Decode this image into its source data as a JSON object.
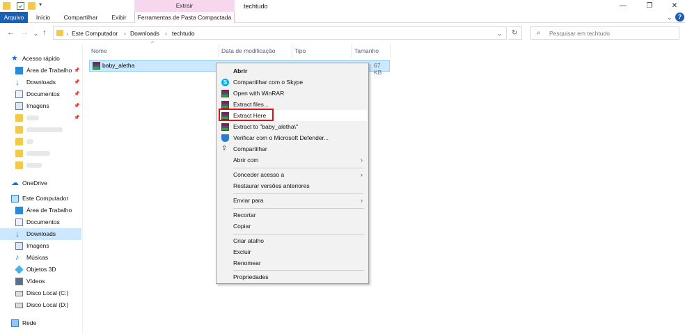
{
  "window": {
    "title": "techtudo",
    "context_header": "Extrair",
    "ribbon_tabs": [
      "Arquivo",
      "Início",
      "Compartilhar",
      "Exibir"
    ],
    "context_tab": "Ferramentas de Pasta Compactada"
  },
  "address": {
    "breadcrumbs": [
      "Este Computador",
      "Downloads",
      "techtudo"
    ],
    "search_placeholder": "Pesquisar em techtudo"
  },
  "nav": {
    "quick_access": "Acesso rápido",
    "quick_items": [
      "Área de Trabalho",
      "Downloads",
      "Documentos",
      "Imagens"
    ],
    "onedrive": "OneDrive",
    "this_pc": "Este Computador",
    "pc_items": [
      "Área de Trabalho",
      "Documentos",
      "Downloads",
      "Imagens",
      "Músicas",
      "Objetos 3D",
      "Vídeos",
      "Disco Local (C:)",
      "Disco Local (D:)"
    ],
    "network": "Rede",
    "selected": "Downloads"
  },
  "columns": [
    "Nome",
    "Data de modificação",
    "Tipo",
    "Tamanho"
  ],
  "file": {
    "name": "baby_aletha",
    "size": "67 KB"
  },
  "menu": {
    "items": [
      "Abrir",
      "Compartilhar com o Skype",
      "Open with WinRAR",
      "Extract files...",
      "Extract Here",
      "Extract to \"baby_aletha\\\"",
      "Verificar com o Microsoft Defender...",
      "Compartilhar",
      "Abrir com",
      "Conceder acesso a",
      "Restaurar versões anteriores",
      "Enviar para",
      "Recortar",
      "Copiar",
      "Criar atalho",
      "Excluir",
      "Renomear",
      "Propriedades"
    ],
    "highlighted": "Extract Here"
  },
  "colors": {
    "accent": "#1a5fb4",
    "selection": "#cce8ff",
    "highlight_box": "#d6141d",
    "context_tab": "#f7d7ee"
  }
}
